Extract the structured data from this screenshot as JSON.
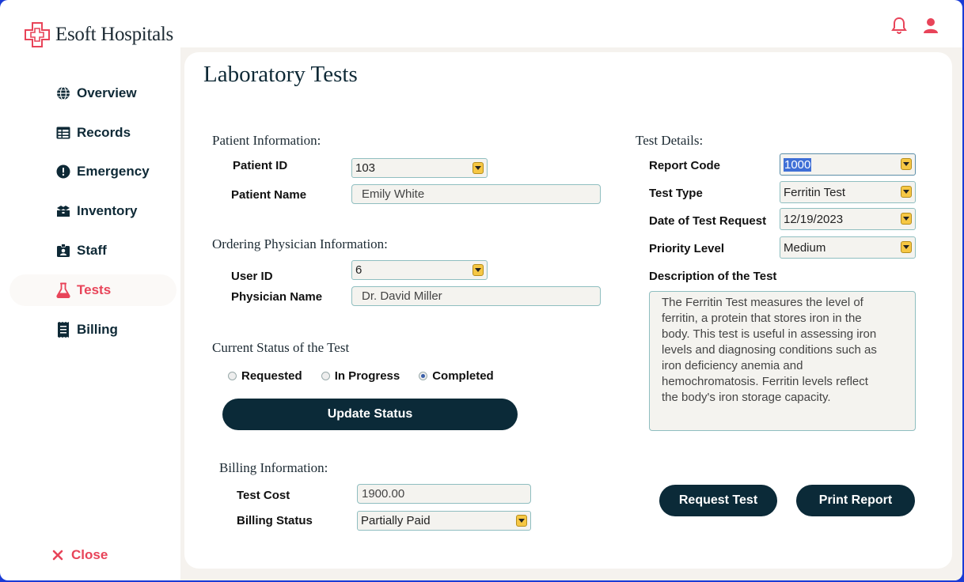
{
  "app": {
    "name": "Esoft Hospitals"
  },
  "colors": {
    "accent": "#e84459",
    "primary": "#0b2a38",
    "dropdown_button": "#f6c744",
    "field_border": "#8fbec0"
  },
  "header": {
    "icons": [
      "bell-icon",
      "user-icon"
    ]
  },
  "sidebar": {
    "items": [
      {
        "label": "Overview",
        "icon": "globe-icon",
        "active": false
      },
      {
        "label": "Records",
        "icon": "table-icon",
        "active": false
      },
      {
        "label": "Emergency",
        "icon": "alert-icon",
        "active": false
      },
      {
        "label": "Inventory",
        "icon": "boxes-icon",
        "active": false
      },
      {
        "label": "Staff",
        "icon": "id-badge-icon",
        "active": false
      },
      {
        "label": "Tests",
        "icon": "flask-icon",
        "active": true
      },
      {
        "label": "Billing",
        "icon": "receipt-icon",
        "active": false
      }
    ],
    "close_label": "Close"
  },
  "page": {
    "title": "Laboratory Tests"
  },
  "patient": {
    "section_title": "Patient Information:",
    "id_label": "Patient ID",
    "id_value": "103",
    "name_label": "Patient Name",
    "name_value": "Emily White"
  },
  "physician": {
    "section_title": "Ordering Physician Information:",
    "user_id_label": "User ID",
    "user_id_value": "6",
    "name_label": "Physician Name",
    "name_value": "Dr. David Miller"
  },
  "status": {
    "section_title": "Current Status of the Test",
    "options": [
      "Requested",
      "In Progress",
      "Completed"
    ],
    "selected": "Completed",
    "update_button": "Update Status"
  },
  "billing": {
    "section_title": "Billing Information:",
    "cost_label": "Test Cost",
    "cost_value": "1900.00",
    "status_label": "Billing Status",
    "status_value": "Partially Paid"
  },
  "test_details": {
    "section_title": "Test Details:",
    "report_code_label": "Report Code",
    "report_code_value": "1000",
    "test_type_label": "Test Type",
    "test_type_value": "Ferritin Test",
    "date_label": "Date of Test Request",
    "date_value": "12/19/2023",
    "priority_label": "Priority Level",
    "priority_value": "Medium",
    "description_label": "Description of the Test",
    "description_lines": [
      "The Ferritin Test measures the level of",
      "ferritin, a protein that stores iron in the",
      "body. This test is useful in assessing iron",
      "levels and diagnosing conditions such as",
      "iron deficiency anemia and",
      "hemochromatosis. Ferritin levels reflect",
      "the body's iron storage capacity."
    ]
  },
  "actions": {
    "request_button": "Request Test",
    "print_button": "Print Report"
  }
}
